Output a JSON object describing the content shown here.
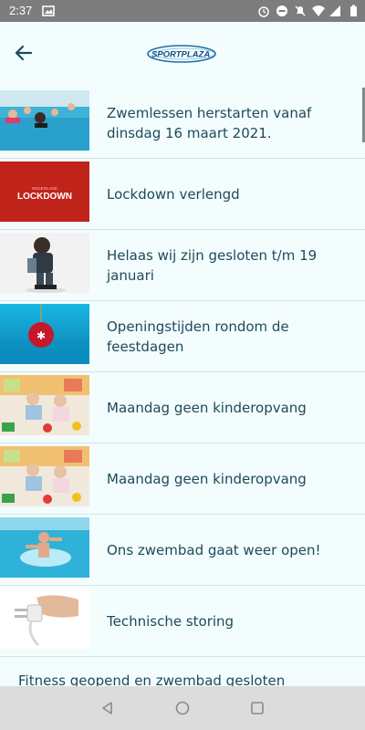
{
  "status": {
    "time": "2:37"
  },
  "appbar": {
    "logo_text": "SPORTPLAZA"
  },
  "items": [
    {
      "title": "Zwemlessen herstarten vanaf dinsdag 16 maart 2021."
    },
    {
      "title": "Lockdown verlengd",
      "thumb_caption": "LOCKDOWN",
      "thumb_small": "NEDERLAND"
    },
    {
      "title": "Helaas wij zijn gesloten t/m 19 januari"
    },
    {
      "title": "Openingstijden rondom de feestdagen"
    },
    {
      "title": "Maandag geen kinderopvang"
    },
    {
      "title": "Maandag geen kinderopvang"
    },
    {
      "title": "Ons zwembad gaat weer open!"
    },
    {
      "title": "Technische storing"
    }
  ],
  "last_item": {
    "title": "Fitness geopend en zwembad gesloten"
  },
  "colors": {
    "title_text": "#1d4a5c",
    "background": "#f3fdfd",
    "status_bar": "#7d7d7d",
    "nav_bar": "#dcdcdc",
    "lockdown_red": "#c0231a"
  }
}
